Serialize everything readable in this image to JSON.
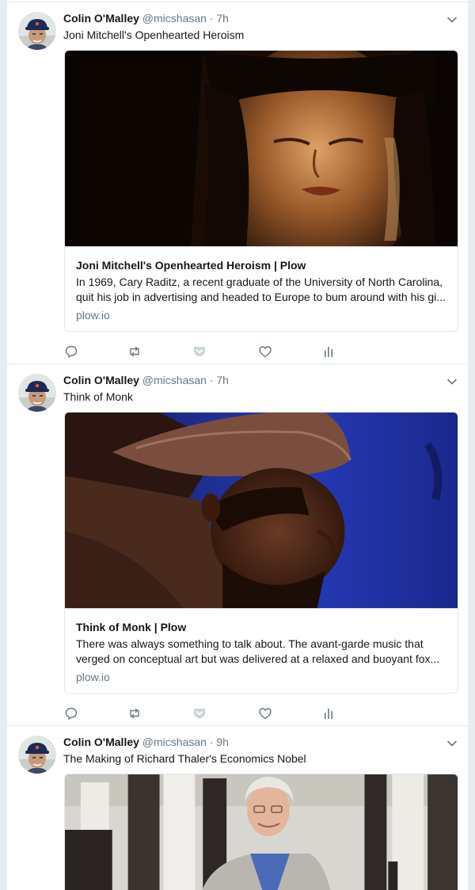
{
  "colors": {
    "accent": "#1da1f2",
    "muted": "#657786",
    "border": "#e6ecf0"
  },
  "tweets": [
    {
      "name": "Colin O'Malley",
      "handle": "@micshasan",
      "dot": "·",
      "time": "7h",
      "text": "Joni Mitchell's Openhearted Heroism",
      "card": {
        "title": "Joni Mitchell's Openhearted Heroism | Plow",
        "description": "In 1969, Cary Raditz, a recent graduate of the University of North Carolina, quit his job in advertising and headed to Europe to bum around with his gi...",
        "domain": "plow.io"
      },
      "icons": [
        "reply-icon",
        "retweet-icon",
        "pocket-icon",
        "like-icon",
        "analytics-icon"
      ]
    },
    {
      "name": "Colin O'Malley",
      "handle": "@micshasan",
      "dot": "·",
      "time": "7h",
      "text": "Think of Monk",
      "card": {
        "title": "Think of Monk | Plow",
        "description": "There was always something to talk about. The avant-garde music that verged on conceptual art but was delivered at a relaxed and buoyant fox...",
        "domain": "plow.io"
      },
      "icons": [
        "reply-icon",
        "retweet-icon",
        "pocket-icon",
        "like-icon",
        "analytics-icon"
      ]
    },
    {
      "name": "Colin O'Malley",
      "handle": "@micshasan",
      "dot": "·",
      "time": "9h",
      "text": "The Making of Richard Thaler's Economics Nobel"
    }
  ]
}
